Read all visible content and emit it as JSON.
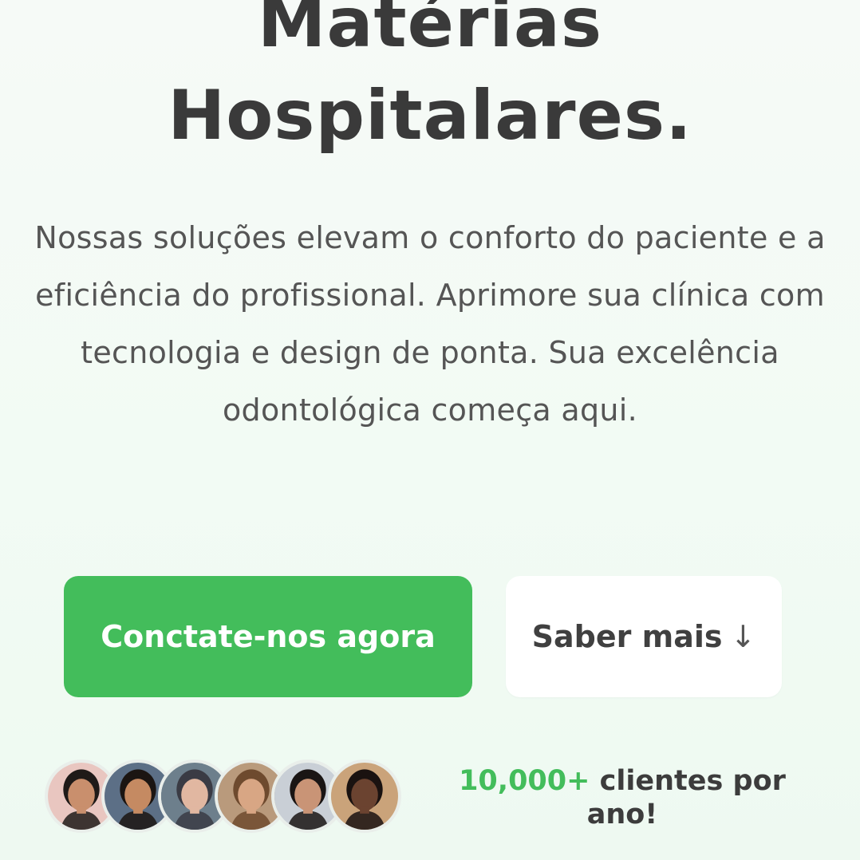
{
  "hero": {
    "title_line_1": "Matérias",
    "title_line_2": "Hospitalares.",
    "description": "Nossas soluções elevam o conforto do paciente e a eficiência do profissional. Aprimore sua clínica com tecnologia e design de ponta. Sua excelência odontológica começa aqui."
  },
  "actions": {
    "primary_label": "Conctate-nos agora",
    "secondary_label": "Saber mais",
    "secondary_icon": "arrow-down-icon",
    "secondary_arrow": "↓"
  },
  "social_proof": {
    "count": "10,000+",
    "text": "clientes por ano!",
    "avatars": [
      {
        "name": "avatar-1",
        "bg": "#e9c6c0",
        "skin": "#c98f6d",
        "hair": "#1f1a18"
      },
      {
        "name": "avatar-2",
        "bg": "#5c6f86",
        "skin": "#c58a62",
        "hair": "#1b1512"
      },
      {
        "name": "avatar-3",
        "bg": "#6d7f8c",
        "skin": "#e1b7a1",
        "hair": "#3a3b44"
      },
      {
        "name": "avatar-4",
        "bg": "#b99a7c",
        "skin": "#d8a684",
        "hair": "#6e4a2e"
      },
      {
        "name": "avatar-5",
        "bg": "#c9cfd6",
        "skin": "#c99476",
        "hair": "#1a1514"
      },
      {
        "name": "avatar-6",
        "bg": "#caa37a",
        "skin": "#6b4330",
        "hair": "#1a1210"
      }
    ]
  },
  "colors": {
    "accent": "#43bd5b",
    "title": "#3a3a3a",
    "body_text": "#555555",
    "background": "#f4fbf5"
  }
}
